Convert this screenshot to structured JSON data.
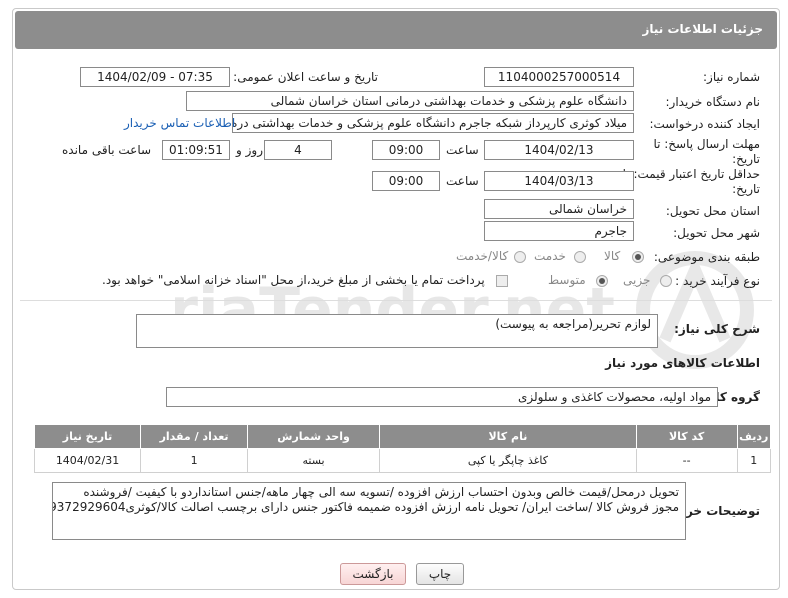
{
  "header": {
    "title": "جزئیات اطلاعات نیاز"
  },
  "fields": {
    "need_number": {
      "label": "شماره نیاز:",
      "value": "1104000257000514"
    },
    "announce_datetime": {
      "label": "تاریخ و ساعت اعلان عمومی:",
      "value": "1404/02/09 - 07:35"
    },
    "buyer_org": {
      "label": "نام دستگاه خریدار:",
      "value": "دانشگاه علوم پزشکی و خدمات بهداشتی درمانی استان خراسان شمالی"
    },
    "requester": {
      "label": "ایجاد کننده درخواست:",
      "value": "میلاد کوثری کارپرداز شبکه جاجرم دانشگاه علوم پزشکی و خدمات بهداشتی دره",
      "contact_link": "اطلاعات تماس خریدار"
    },
    "reply_deadline": {
      "label": "مهلت ارسال پاسخ: تا تاریخ:",
      "date": "1404/02/13",
      "time_label": "ساعت",
      "time": "09:00",
      "days": "4",
      "days_label": "روز و",
      "remaining": "01:09:51",
      "remaining_label": "ساعت باقی مانده"
    },
    "price_validity": {
      "label": "حداقل تاریخ اعتبار قیمت: تا تاریخ:",
      "date": "1404/03/13",
      "time_label": "ساعت",
      "time": "09:00"
    },
    "delivery_province": {
      "label": "استان محل تحویل:",
      "value": "خراسان شمالی"
    },
    "delivery_city": {
      "label": "شهر محل تحویل:",
      "value": "جاجرم"
    },
    "category": {
      "label": "طبقه بندی موضوعی:",
      "options": [
        "کالا",
        "خدمت",
        "کالا/خدمت"
      ],
      "selected": "کالا"
    },
    "process_type": {
      "label": "نوع فرآیند خرید :",
      "options": [
        "جزیی",
        "متوسط"
      ],
      "selected": "متوسط",
      "payment_note": "پرداخت تمام یا بخشی از مبلغ خرید،از محل \"اسناد خزانه اسلامی\" خواهد بود."
    }
  },
  "general_description": {
    "label": "شرح کلی نیاز:",
    "value": "لوازم تحریر(مراجعه به پیوست)"
  },
  "goods_section": {
    "title": "اطلاعات کالاهای مورد نیاز",
    "group_label": "گروه کالا:",
    "group_value": "مواد اولیه، محصولات کاغذی و سلولزی"
  },
  "items_table": {
    "headers": [
      "ردیف",
      "کد کالا",
      "نام کالا",
      "واحد شمارش",
      "تعداد / مقدار",
      "تاریخ نیاز"
    ],
    "rows": [
      [
        "1",
        "--",
        "کاغذ چاپگر یا کپی",
        "بسته",
        "1",
        "1404/02/31"
      ]
    ]
  },
  "buyer_notes": {
    "label": "توضیحات خریدار:",
    "line1": "تحویل درمحل/قیمت خالص وبدون احتساب ارزش افزوده /تسویه سه الی چهار ماهه/جنس استانداردو با کیفیت /فروشنده",
    "line2": "مجوز فروش کالا /ساخت ایران/ تحویل  نامه ارزش افزوده ضمیمه  فاکتور جنس دارای برچسب اصالت کالا/کوثری09372929604"
  },
  "buttons": {
    "print": "چاپ",
    "back": "بازگشت"
  },
  "watermark": {
    "text": "AriaTender.net"
  },
  "colors": {
    "header_bg": "#8d8d8d",
    "link": "#1a5fb4",
    "back_button": "#f7d5d5"
  }
}
